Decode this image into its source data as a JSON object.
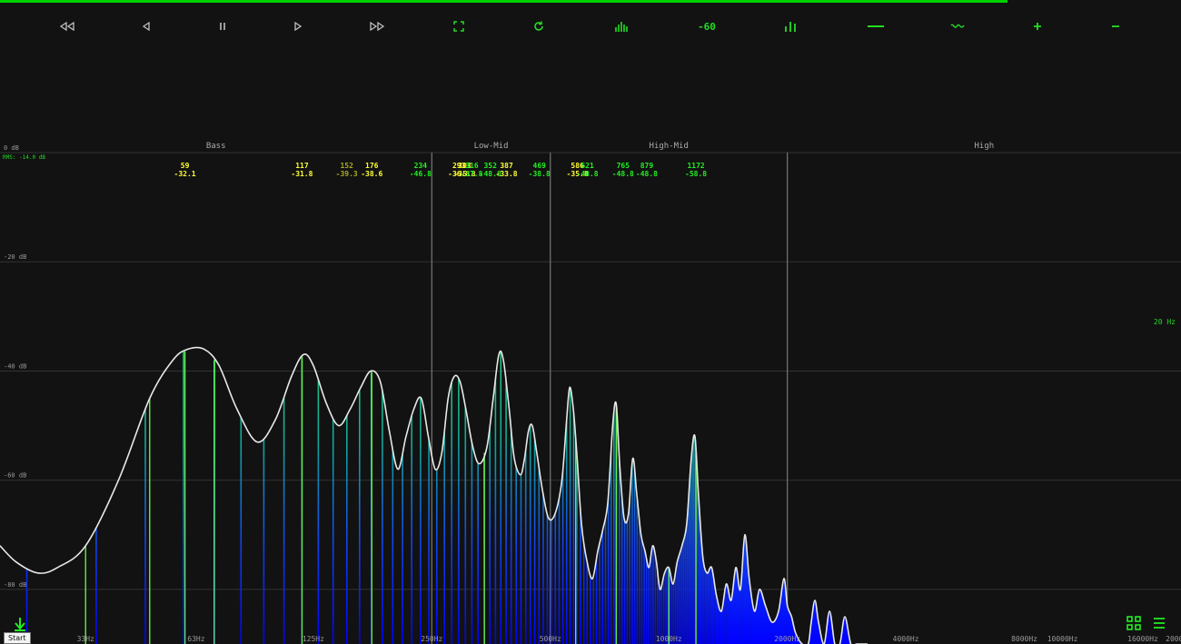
{
  "progress": 0.853,
  "toolbar": [
    {
      "name": "rewind-button",
      "icon": "double-triangle-left",
      "color": "gray"
    },
    {
      "name": "prev-button",
      "icon": "triangle-left",
      "color": "gray"
    },
    {
      "name": "pause-button",
      "icon": "pause",
      "color": "gray"
    },
    {
      "name": "play-button",
      "icon": "triangle-right",
      "color": "gray"
    },
    {
      "name": "fast-forward-button",
      "icon": "double-triangle-right",
      "color": "gray"
    },
    {
      "name": "fullscreen-button",
      "icon": "fullscreen",
      "color": "green"
    },
    {
      "name": "refresh-button",
      "icon": "refresh",
      "color": "green"
    },
    {
      "name": "bars-view-button",
      "icon": "bars",
      "color": "green"
    },
    {
      "name": "floor-60-button",
      "icon": "text",
      "label": "-60",
      "color": "green"
    },
    {
      "name": "bars-toggle-button",
      "icon": "three-bars",
      "color": "green"
    },
    {
      "name": "flat-line-button",
      "icon": "line",
      "color": "green"
    },
    {
      "name": "wave-button",
      "icon": "wave",
      "color": "green"
    },
    {
      "name": "plus-button",
      "icon": "plus",
      "color": "green"
    },
    {
      "name": "minus-button",
      "icon": "minus",
      "color": "green"
    }
  ],
  "bands": [
    "Bass",
    "Low-Mid",
    "High-Mid",
    "High"
  ],
  "rms": "RMS: -14.0 dB",
  "hz20": "20 Hz",
  "start_label": "Start",
  "chart_data": {
    "type": "area",
    "xscale": "log",
    "xlim": [
      20,
      20000
    ],
    "ylim": [
      -90,
      0
    ],
    "db_ticks": [
      "0 dB",
      "-20 dB",
      "-40 dB",
      "-60 dB",
      "-80 dB"
    ],
    "db_values": [
      0,
      -20,
      -40,
      -60,
      -80
    ],
    "freq_ticks": [
      {
        "hz": 33,
        "label": "33Hz"
      },
      {
        "hz": 63,
        "label": "63Hz"
      },
      {
        "hz": 125,
        "label": "125Hz"
      },
      {
        "hz": 250,
        "label": "250Hz"
      },
      {
        "hz": 500,
        "label": "500Hz"
      },
      {
        "hz": 1000,
        "label": "1000Hz"
      },
      {
        "hz": 2000,
        "label": "2000Hz"
      },
      {
        "hz": 4000,
        "label": "4000Hz"
      },
      {
        "hz": 8000,
        "label": "8000Hz"
      },
      {
        "hz": 10000,
        "label": "10000Hz"
      },
      {
        "hz": 16000,
        "label": "16000Hz"
      },
      {
        "hz": 20000,
        "label": "20000Hz"
      }
    ],
    "band_edges_hz": [
      250,
      500,
      2000
    ],
    "envelope": [
      [
        20,
        -72
      ],
      [
        22,
        -75
      ],
      [
        25,
        -77
      ],
      [
        28,
        -76
      ],
      [
        33,
        -72
      ],
      [
        40,
        -60
      ],
      [
        48,
        -45
      ],
      [
        55,
        -38
      ],
      [
        60,
        -36
      ],
      [
        66,
        -36
      ],
      [
        72,
        -39
      ],
      [
        80,
        -47
      ],
      [
        90,
        -53
      ],
      [
        100,
        -49
      ],
      [
        110,
        -41
      ],
      [
        118,
        -37
      ],
      [
        125,
        -39
      ],
      [
        135,
        -46
      ],
      [
        145,
        -50
      ],
      [
        155,
        -47
      ],
      [
        165,
        -43
      ],
      [
        175,
        -40
      ],
      [
        185,
        -42
      ],
      [
        195,
        -51
      ],
      [
        205,
        -58
      ],
      [
        215,
        -52
      ],
      [
        225,
        -47
      ],
      [
        235,
        -45
      ],
      [
        245,
        -52
      ],
      [
        255,
        -58
      ],
      [
        265,
        -55
      ],
      [
        275,
        -45
      ],
      [
        285,
        -41
      ],
      [
        295,
        -42
      ],
      [
        305,
        -47
      ],
      [
        318,
        -54
      ],
      [
        330,
        -57
      ],
      [
        345,
        -54
      ],
      [
        358,
        -45
      ],
      [
        370,
        -37
      ],
      [
        380,
        -38
      ],
      [
        393,
        -47
      ],
      [
        405,
        -56
      ],
      [
        420,
        -59
      ],
      [
        430,
        -56
      ],
      [
        440,
        -51
      ],
      [
        450,
        -50
      ],
      [
        462,
        -55
      ],
      [
        478,
        -62
      ],
      [
        495,
        -67
      ],
      [
        515,
        -66
      ],
      [
        535,
        -60
      ],
      [
        550,
        -49
      ],
      [
        560,
        -43
      ],
      [
        572,
        -47
      ],
      [
        585,
        -56
      ],
      [
        600,
        -68
      ],
      [
        620,
        -75
      ],
      [
        640,
        -78
      ],
      [
        660,
        -73
      ],
      [
        680,
        -69
      ],
      [
        700,
        -64
      ],
      [
        720,
        -50
      ],
      [
        735,
        -46
      ],
      [
        750,
        -57
      ],
      [
        770,
        -67
      ],
      [
        790,
        -66
      ],
      [
        810,
        -56
      ],
      [
        830,
        -63
      ],
      [
        850,
        -70
      ],
      [
        870,
        -73
      ],
      [
        890,
        -76
      ],
      [
        910,
        -72
      ],
      [
        930,
        -75
      ],
      [
        950,
        -80
      ],
      [
        975,
        -77
      ],
      [
        1000,
        -76
      ],
      [
        1025,
        -79
      ],
      [
        1050,
        -75
      ],
      [
        1080,
        -72
      ],
      [
        1110,
        -68
      ],
      [
        1140,
        -56
      ],
      [
        1165,
        -52
      ],
      [
        1190,
        -63
      ],
      [
        1220,
        -74
      ],
      [
        1250,
        -77
      ],
      [
        1285,
        -76
      ],
      [
        1320,
        -81
      ],
      [
        1360,
        -84
      ],
      [
        1400,
        -79
      ],
      [
        1440,
        -82
      ],
      [
        1480,
        -76
      ],
      [
        1520,
        -80
      ],
      [
        1560,
        -70
      ],
      [
        1600,
        -78
      ],
      [
        1650,
        -84
      ],
      [
        1700,
        -80
      ],
      [
        1760,
        -83
      ],
      [
        1830,
        -86
      ],
      [
        1900,
        -84
      ],
      [
        1960,
        -78
      ],
      [
        2000,
        -83
      ],
      [
        2050,
        -85
      ],
      [
        2100,
        -88
      ],
      [
        2180,
        -90
      ],
      [
        2260,
        -90
      ],
      [
        2300,
        -86
      ],
      [
        2350,
        -82
      ],
      [
        2400,
        -86
      ],
      [
        2480,
        -90
      ],
      [
        2560,
        -84
      ],
      [
        2640,
        -90
      ],
      [
        2720,
        -90
      ],
      [
        2800,
        -85
      ],
      [
        2900,
        -90
      ],
      [
        3000,
        -90
      ],
      [
        3200,
        -90
      ]
    ],
    "green_markers_hz": [
      33,
      48,
      59,
      70,
      117,
      176,
      340,
      580,
      735,
      1000,
      1172
    ],
    "peaks": [
      {
        "hz": "59",
        "db": "-32.1",
        "color": "#ffff33"
      },
      {
        "hz": "117",
        "db": "-31.8",
        "color": "#ffff33"
      },
      {
        "hz": "152",
        "db": "-39.3",
        "color": "#aaaa22"
      },
      {
        "hz": "176",
        "db": "-38.6",
        "color": "#ffff33"
      },
      {
        "hz": "234",
        "db": "-46.8",
        "color": "#22ee22"
      },
      {
        "hz": "293",
        "db": "-36.8",
        "color": "#ffff33"
      },
      {
        "hz": "303",
        "db": "-35.8",
        "color": "#ffff33"
      },
      {
        "hz": "316",
        "db": "-37.8",
        "color": "#22ee22"
      },
      {
        "hz": "352",
        "db": "-48.8",
        "color": "#22ee22"
      },
      {
        "hz": "387",
        "db": "-33.8",
        "color": "#ffff33"
      },
      {
        "hz": "469",
        "db": "-38.8",
        "color": "#22ee22"
      },
      {
        "hz": "586",
        "db": "-35.8",
        "color": "#ffff33"
      },
      {
        "hz": "621",
        "db": "-48.8",
        "color": "#22ee22"
      },
      {
        "hz": "765",
        "db": "-48.8",
        "color": "#22ee22"
      },
      {
        "hz": "879",
        "db": "-48.8",
        "color": "#22ee22"
      },
      {
        "hz": "1172",
        "db": "-58.8",
        "color": "#22ee22"
      }
    ]
  }
}
